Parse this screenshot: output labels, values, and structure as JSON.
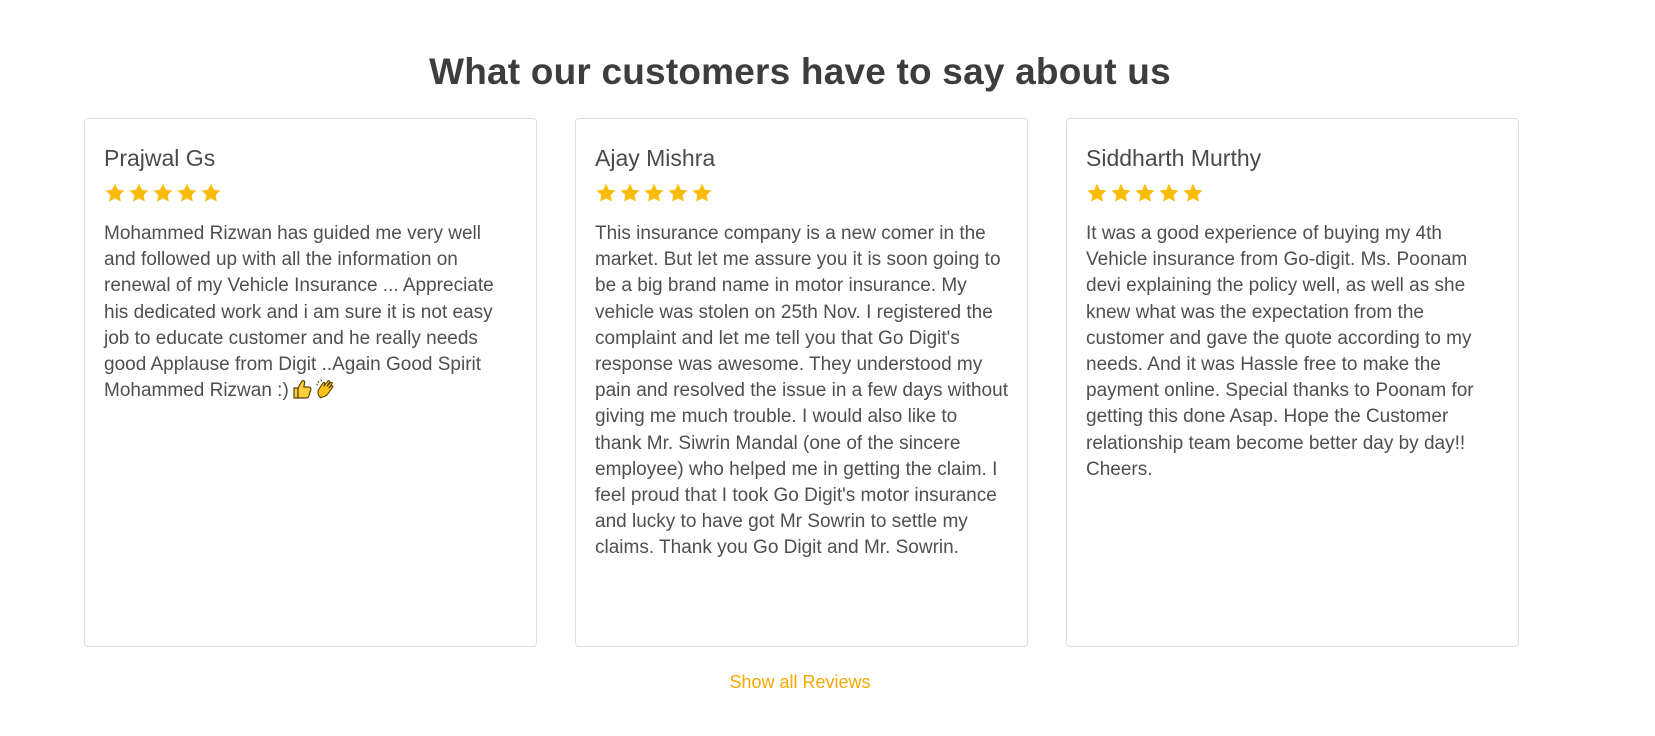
{
  "heading": "What our customers have to say about us",
  "accent_color": "#f5a800",
  "star_color": "#fbbc05",
  "reviews": [
    {
      "name": "Prajwal Gs",
      "rating": 5,
      "text": "Mohammed Rizwan has guided me very well and followed up with all the information on renewal of my Vehicle Insurance ... Appreciate his dedicated work and i am sure it is not easy job to educate customer and he really needs good Applause from Digit ..Again Good Spirit Mohammed Rizwan :)",
      "emojis": [
        "thumbs-up-icon",
        "clapping-hands-icon"
      ]
    },
    {
      "name": "Ajay Mishra",
      "rating": 5,
      "text": "This insurance company is a new comer in the market. But let me assure you it is soon going to be a big brand name in motor insurance. My vehicle was stolen on 25th Nov. I registered the complaint and let me tell you that Go Digit's response was awesome. They understood my pain and resolved the issue in a few days without giving me much trouble. I would also like to thank Mr. Siwrin Mandal (one of the sincere employee) who helped me in getting the claim. I feel proud that I took Go Digit's motor insurance and lucky to have got Mr Sowrin to settle my claims. Thank you Go Digit and Mr. Sowrin."
    },
    {
      "name": "Siddharth Murthy",
      "rating": 5,
      "text": "It was a good experience of buying my 4th Vehicle insurance from Go-digit. Ms. Poonam devi explaining the policy well, as well as she knew what was the expectation from the customer and gave the quote according to my needs. And it was Hassle free to make the payment online. Special thanks to Poonam for getting this done Asap. Hope the Customer relationship team become better day by day!! Cheers."
    }
  ],
  "show_all_label": "Show all Reviews"
}
